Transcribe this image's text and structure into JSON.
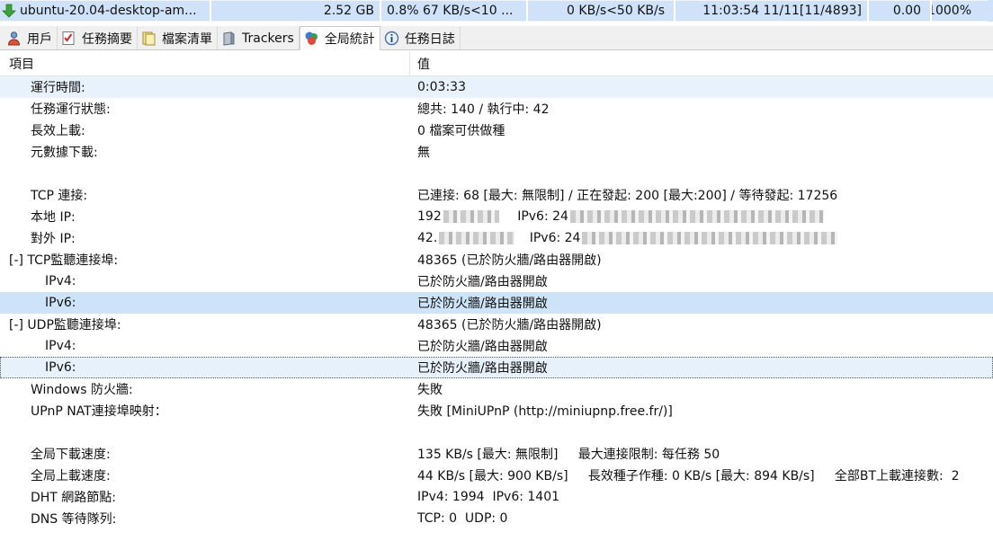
{
  "statusbar": {
    "name": "ubuntu-20.04-desktop-am...",
    "size": "2.52 GB",
    "down": "0.8% 67 KB/s<10 ...",
    "up": "0 KB/s<50 KB/s",
    "time": "11:03:54 11/11[11/4893]",
    "ratio": "0.00",
    "percent": "1000%",
    "icon": "download-arrow-icon"
  },
  "tabs": [
    {
      "label": "用戶",
      "icon": "user-icon"
    },
    {
      "label": "任務摘要",
      "icon": "checklist-icon"
    },
    {
      "label": "檔案清單",
      "icon": "folder-icon"
    },
    {
      "label": "Trackers",
      "icon": "tracker-icon"
    },
    {
      "label": "全局統計",
      "icon": "stats-icon"
    },
    {
      "label": "任務日誌",
      "icon": "info-icon"
    }
  ],
  "list": {
    "col_item": "項目",
    "col_value": "值",
    "rows": [
      {
        "item": "運行時間:",
        "value": "0:03:33"
      },
      {
        "item": "任務運行狀態:",
        "value": "總共: 140 / 執行中: 42"
      },
      {
        "item": "長效上載:",
        "value": "0 檔案可供做種"
      },
      {
        "item": "元數據下載:",
        "value": "無"
      },
      {
        "item": "",
        "value": ""
      },
      {
        "item": "TCP 連接:",
        "value": "已連接: 68 [最大: 無限制] / 正在發起: 200 [最大:200] / 等待發起: 17256"
      },
      {
        "item": "本地 IP:",
        "value_a": "192",
        "value_b": "IPv6: 24"
      },
      {
        "item": "對外 IP:",
        "value_a": "42.",
        "value_b": "IPv6: 24"
      },
      {
        "item": "[-] TCP監聽連接埠:",
        "value": "48365 (已於防火牆/路由器開啟)"
      },
      {
        "item": "IPv4:",
        "value": "已於防火牆/路由器開啟"
      },
      {
        "item": "IPv6:",
        "value": "已於防火牆/路由器開啟"
      },
      {
        "item": "[-] UDP監聽連接埠:",
        "value": "48365 (已於防火牆/路由器開啟)"
      },
      {
        "item": "IPv4:",
        "value": "已於防火牆/路由器開啟"
      },
      {
        "item": "IPv6:",
        "value": "已於防火牆/路由器開啟"
      },
      {
        "item": "Windows 防火牆:",
        "value": "失敗"
      },
      {
        "item": "UPnP NAT連接埠映射：",
        "value": "失敗 [MiniUPnP (http://miniupnp.free.fr/)]"
      },
      {
        "item": "",
        "value": ""
      },
      {
        "item": "全局下載速度:",
        "value": "135 KB/s [最大: 無限制]     最大連接限制: 每任務 50"
      },
      {
        "item": "全局上載速度:",
        "value": "44 KB/s [最大: 900 KB/s]     長效種子作種: 0 KB/s [最大: 894 KB/s]     全部BT上載連接數:  2"
      },
      {
        "item": "DHT 網路節點:",
        "value": "IPv4: 1994  IPv6: 1401"
      },
      {
        "item": "DNS 等待隊列:",
        "value": "TCP: 0  UDP: 0"
      }
    ]
  },
  "colors": {
    "status_bg": "#cfe2f9",
    "selected_row": "#cde4f8",
    "first_row": "#e8f2fc"
  }
}
